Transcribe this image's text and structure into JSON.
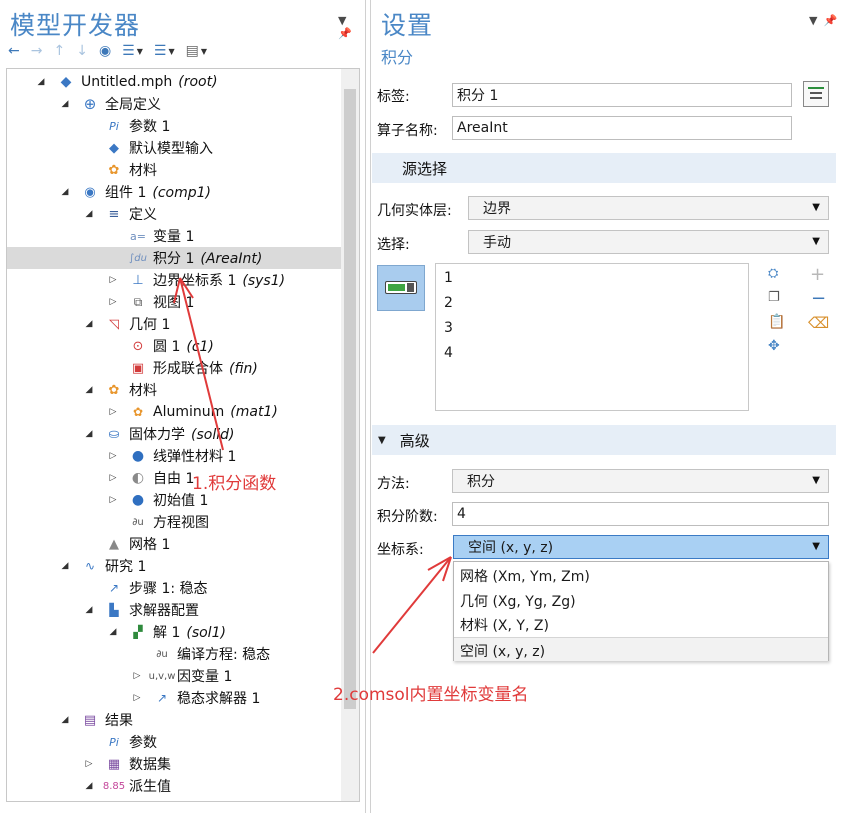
{
  "left": {
    "title": "模型开发器",
    "tree": [
      {
        "label": "Untitled.mph",
        "tag": "(root)",
        "icon": "model-file-icon",
        "toggle": "expanded"
      },
      {
        "label": "全局定义",
        "tag": "",
        "icon": "globe-icon",
        "toggle": "expanded"
      },
      {
        "label": "参数 1",
        "tag": "",
        "icon": "parameters-icon",
        "toggle": ""
      },
      {
        "label": "默认模型输入",
        "tag": "",
        "icon": "model-input-icon",
        "toggle": ""
      },
      {
        "label": "材料",
        "tag": "",
        "icon": "materials-icon",
        "toggle": ""
      },
      {
        "label": "组件 1",
        "tag": "(comp1)",
        "icon": "component-icon",
        "toggle": "expanded"
      },
      {
        "label": "定义",
        "tag": "",
        "icon": "definitions-icon",
        "toggle": "expanded"
      },
      {
        "label": "变量 1",
        "tag": "",
        "icon": "variables-icon",
        "toggle": ""
      },
      {
        "label": "积分 1",
        "tag": "(AreaInt)",
        "icon": "integration-icon",
        "toggle": "",
        "selected": true
      },
      {
        "label": "边界坐标系 1",
        "tag": "(sys1)",
        "icon": "boundary-system-icon",
        "toggle": "collapsed"
      },
      {
        "label": "视图 1",
        "tag": "",
        "icon": "view-icon",
        "toggle": "collapsed"
      },
      {
        "label": "几何 1",
        "tag": "",
        "icon": "geometry-icon",
        "toggle": "expanded"
      },
      {
        "label": "圆 1",
        "tag": "(c1)",
        "icon": "circle-icon",
        "toggle": ""
      },
      {
        "label": "形成联合体",
        "tag": "(fin)",
        "icon": "form-union-icon",
        "toggle": ""
      },
      {
        "label": "材料",
        "tag": "",
        "icon": "materials-icon",
        "toggle": "expanded"
      },
      {
        "label": "Aluminum",
        "tag": "(mat1)",
        "icon": "material-icon",
        "toggle": "collapsed"
      },
      {
        "label": "固体力学",
        "tag": "(solid)",
        "icon": "solid-mechanics-icon",
        "toggle": "expanded"
      },
      {
        "label": "线弹性材料 1",
        "tag": "",
        "icon": "physics-feature-icon",
        "toggle": "collapsed"
      },
      {
        "label": "自由 1",
        "tag": "",
        "icon": "free-icon",
        "toggle": "collapsed"
      },
      {
        "label": "初始值 1",
        "tag": "",
        "icon": "initial-values-icon",
        "toggle": "collapsed"
      },
      {
        "label": "方程视图",
        "tag": "",
        "icon": "equation-view-icon",
        "toggle": ""
      },
      {
        "label": "网格 1",
        "tag": "",
        "icon": "mesh-icon",
        "toggle": ""
      },
      {
        "label": "研究 1",
        "tag": "",
        "icon": "study-icon",
        "toggle": "expanded"
      },
      {
        "label": "步骤 1: 稳态",
        "tag": "",
        "icon": "stationary-step-icon",
        "toggle": ""
      },
      {
        "label": "求解器配置",
        "tag": "",
        "icon": "solver-config-icon",
        "toggle": "expanded"
      },
      {
        "label": "解 1",
        "tag": "(sol1)",
        "icon": "solution-icon",
        "toggle": "expanded"
      },
      {
        "label": "编译方程: 稳态",
        "tag": "",
        "icon": "compile-equations-icon",
        "toggle": ""
      },
      {
        "label": "因变量 1",
        "tag": "",
        "icon": "dependent-variables-icon",
        "toggle": "collapsed"
      },
      {
        "label": "稳态求解器 1",
        "tag": "",
        "icon": "stationary-solver-icon",
        "toggle": "collapsed"
      },
      {
        "label": "结果",
        "tag": "",
        "icon": "results-icon",
        "toggle": "expanded"
      },
      {
        "label": "参数",
        "tag": "",
        "icon": "parameters-icon",
        "toggle": ""
      },
      {
        "label": "数据集",
        "tag": "",
        "icon": "datasets-icon",
        "toggle": "collapsed"
      },
      {
        "label": "派生值",
        "tag": "",
        "icon": "derived-values-icon",
        "toggle": "expanded"
      }
    ]
  },
  "right": {
    "title": "设置",
    "subtitle": "积分",
    "label_field": {
      "label": "标签:",
      "value": "积分 1"
    },
    "operator_field": {
      "label": "算子名称:",
      "value": "AreaInt"
    },
    "source_section": {
      "title": "源选择"
    },
    "geom_level": {
      "label": "几何实体层:",
      "value": "边界"
    },
    "selection": {
      "label": "选择:",
      "value": "手动",
      "items": [
        "1",
        "2",
        "3",
        "4"
      ]
    },
    "advanced_section": {
      "title": "高级"
    },
    "method": {
      "label": "方法:",
      "value": "积分"
    },
    "order": {
      "label": "积分阶数:",
      "value": "4"
    },
    "coord": {
      "label": "坐标系:",
      "value": "空间  (x, y, z)",
      "options": [
        "网格  (Xm, Ym, Zm)",
        "几何  (Xg, Yg, Zg)",
        "材料  (X, Y, Z)",
        "空间  (x, y, z)"
      ]
    }
  },
  "annotations": {
    "a1": "1.积分函数",
    "a2": "2.comsol内置坐标变量名"
  },
  "colors": {
    "accent": "#4a87c6",
    "annotation": "#e03a3a",
    "section_bar": "#e6eef7",
    "selection": "#dadada"
  }
}
